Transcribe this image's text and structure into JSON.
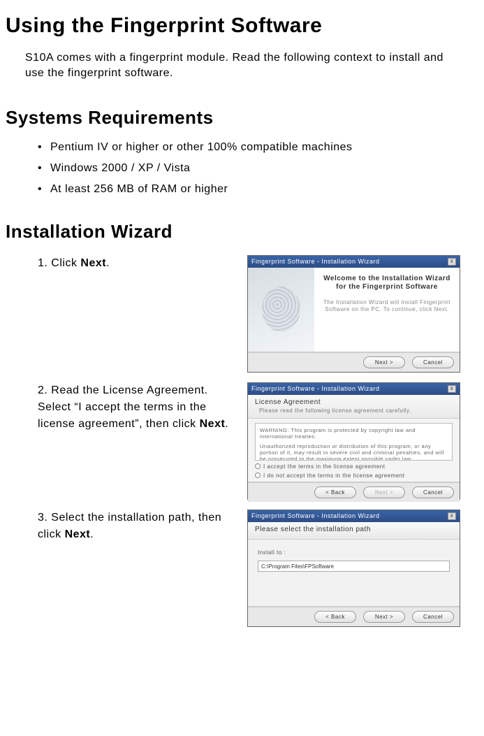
{
  "title": "Using the Fingerprint Software",
  "intro": "S10A comes with a fingerprint module. Read the following context to install and use the fingerprint software.",
  "sections": {
    "requirements": {
      "heading": "Systems Requirements",
      "items": [
        "Pentium IV or higher or other 100% compatible machines",
        "Windows 2000 / XP / Vista",
        "At least 256 MB of RAM or higher"
      ]
    },
    "wizard": {
      "heading": "Installation Wizard",
      "steps": [
        {
          "num": "1.",
          "text_pre": "Click ",
          "bold": "Next",
          "text_post": "."
        },
        {
          "num": "2.",
          "text_pre": "Read the License Agreement. Select “I accept the terms in the license agreement”, then click ",
          "bold": "Next",
          "text_post": "."
        },
        {
          "num": "3.",
          "text_pre": "Select the installation path, then click ",
          "bold": "Next",
          "text_post": "."
        }
      ]
    }
  },
  "dialogs": {
    "shared": {
      "title": "Fingerprint Software - Installation Wizard",
      "close_icon": "x"
    },
    "d1": {
      "welcome_title": "Welcome to the Installation Wizard for the Fingerprint Software",
      "welcome_desc": "The Installation Wizard will install Fingerprint Software on the PC. To continue, click Next.",
      "btn_next": "Next >",
      "btn_cancel": "Cancel"
    },
    "d2": {
      "header_title": "License Agreement",
      "header_sub": "Please read the following license agreement carefully.",
      "lic_line1": "WARNING: This program is protected by copyright law and international treaties.",
      "lic_line2": "Unauthorized reproduction or distribution of this program, or any portion of it, may result in severe civil and criminal penalties, and will be prosecuted to the maximum extent possible under law.",
      "radio_accept": "I accept the terms in the license agreement",
      "radio_decline": "I do not accept the terms in the license agreement",
      "btn_back": "< Back",
      "btn_next": "Next >",
      "btn_cancel": "Cancel"
    },
    "d3": {
      "header_title": "Please select the installation path",
      "install_to": "Install to :",
      "path_value": "C:\\Program Files\\FPSoftware",
      "btn_back": "< Back",
      "btn_next": "Next >",
      "btn_cancel": "Cancel"
    }
  }
}
